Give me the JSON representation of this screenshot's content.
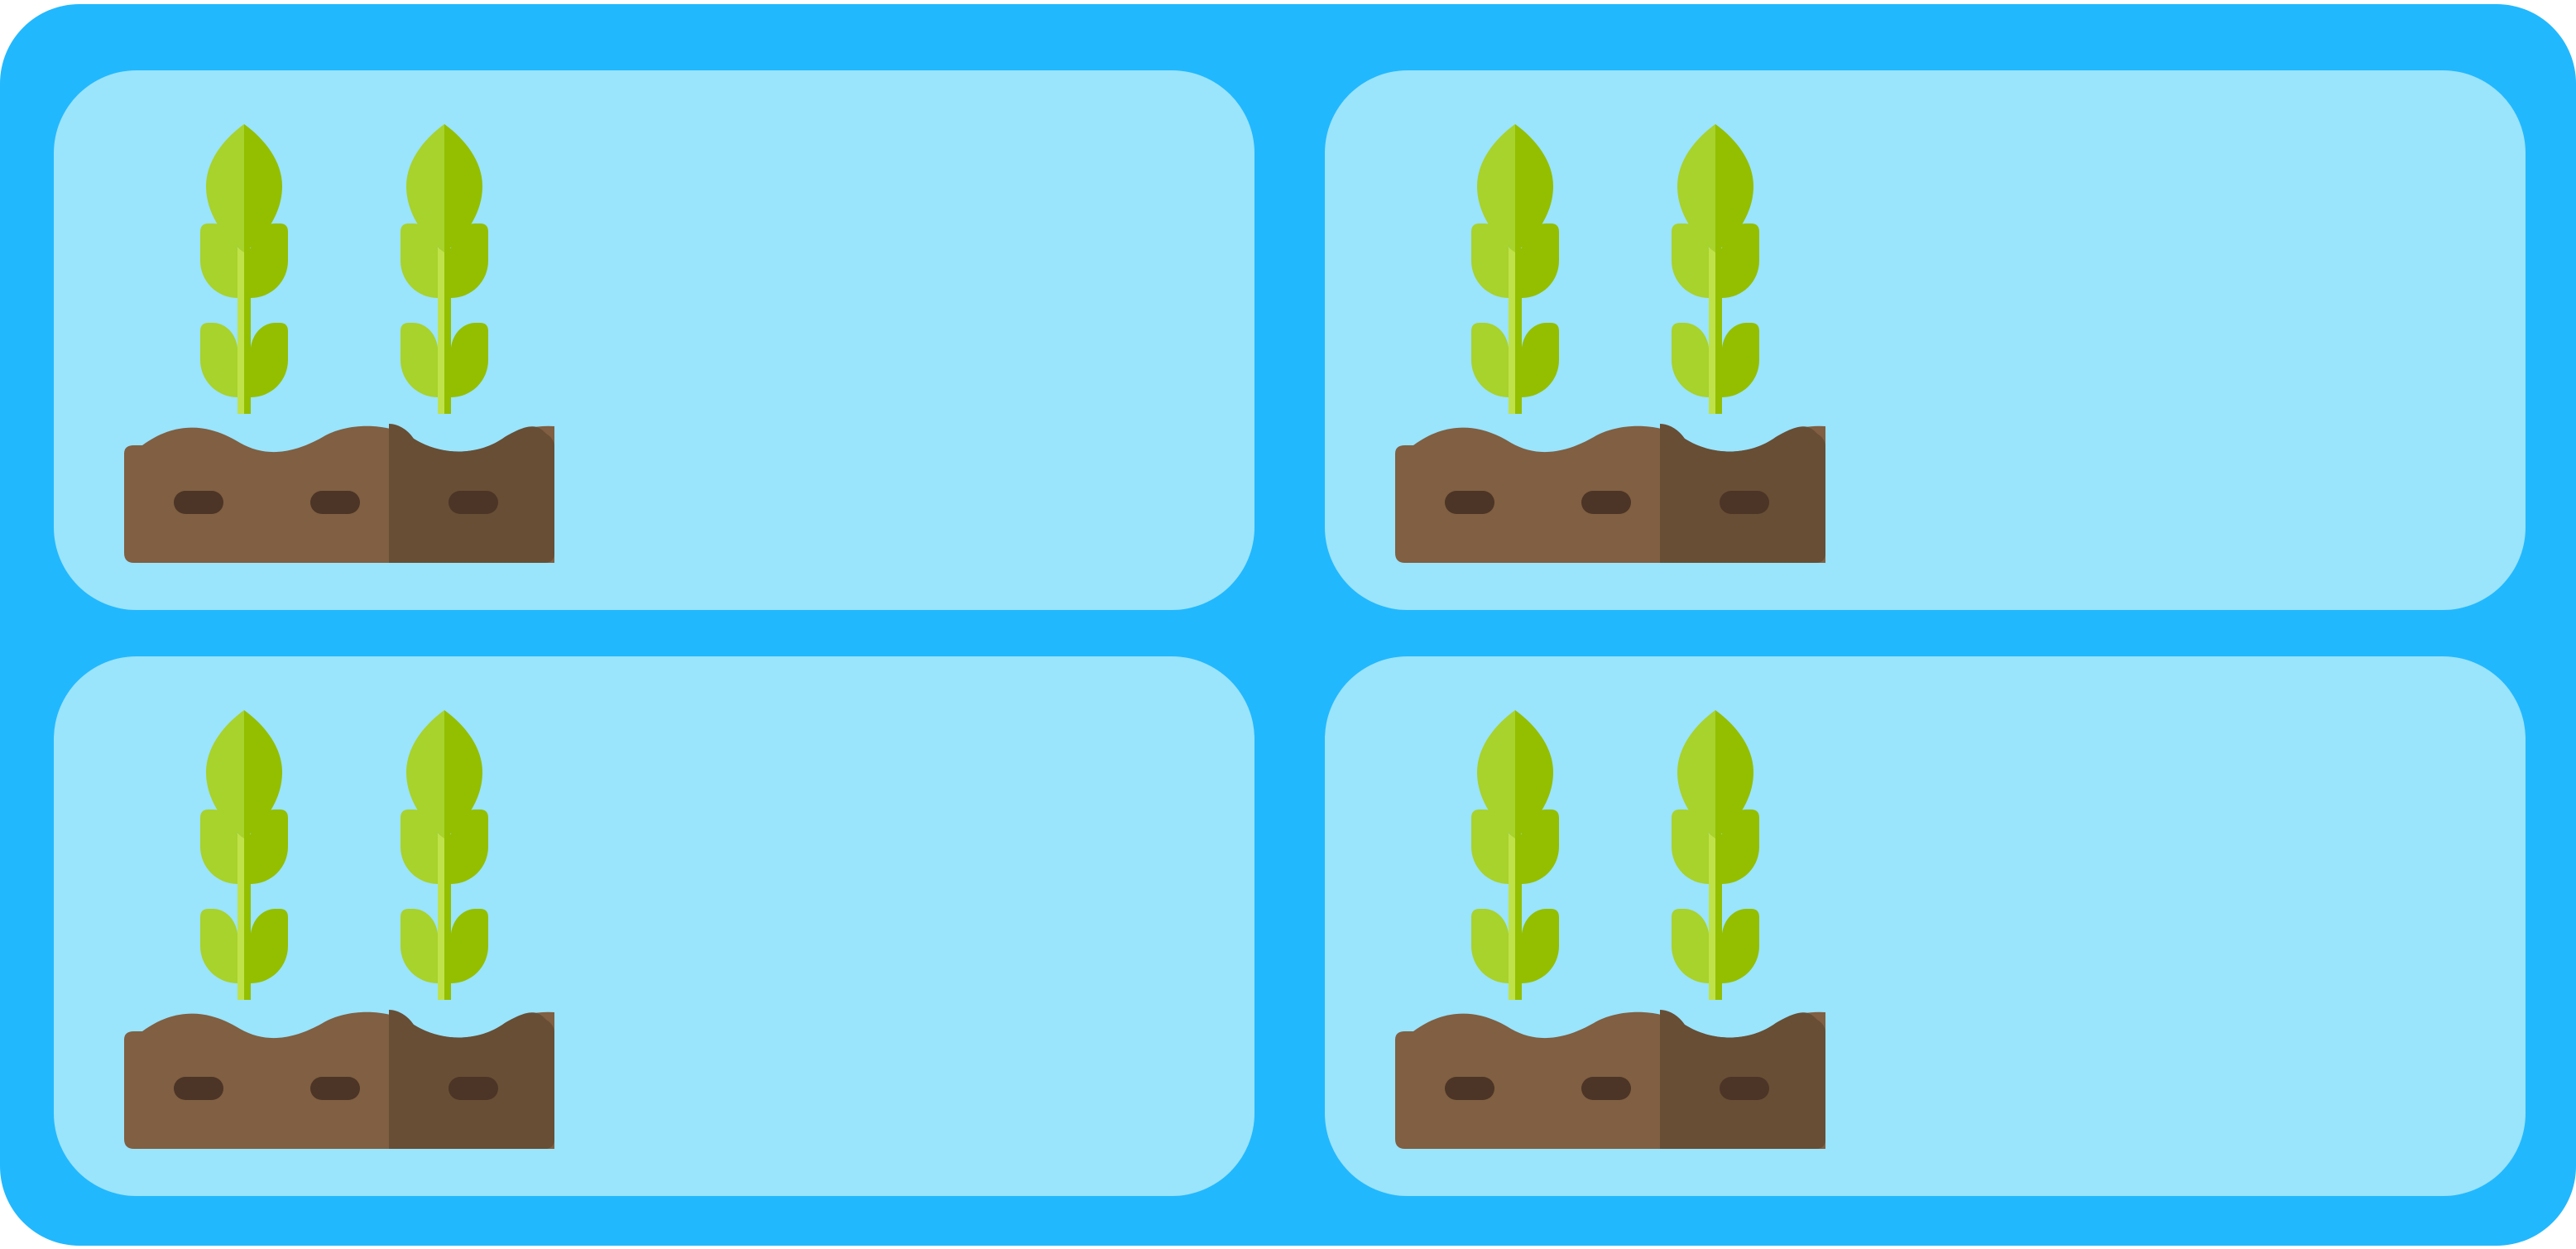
{
  "board": {
    "background_color": "#22b8fd",
    "plot_color": "#9ae4fc",
    "plots": [
      {
        "crop_icon": "growing-crop-icon"
      },
      {
        "crop_icon": "growing-crop-icon"
      },
      {
        "crop_icon": "growing-crop-icon"
      },
      {
        "crop_icon": "growing-crop-icon"
      }
    ]
  },
  "palette": {
    "leaf_light": "#a8d22c",
    "leaf_dark": "#93bf00",
    "stem_light": "#bfe24a",
    "soil_light": "#805f42",
    "soil_dark": "#674e35",
    "soil_hole": "#4c3526"
  }
}
